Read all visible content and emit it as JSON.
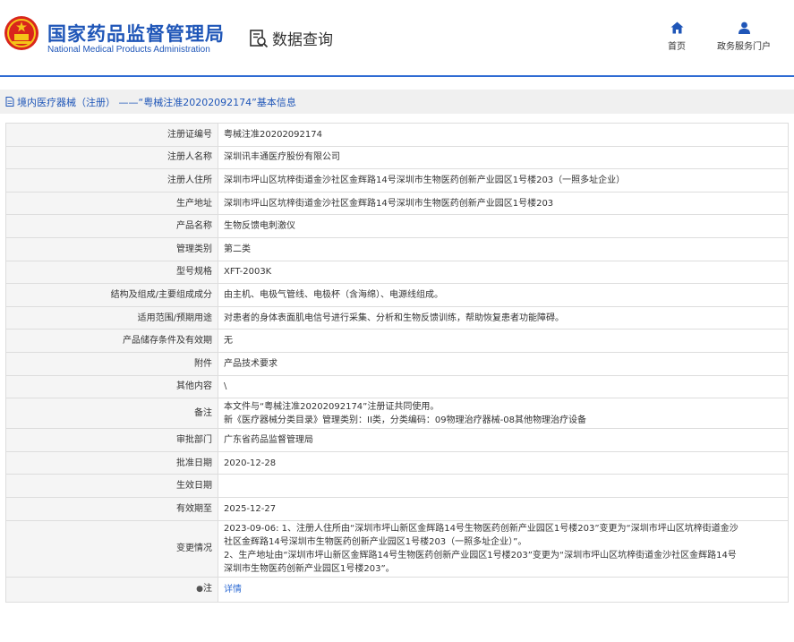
{
  "header": {
    "brand_cn": "国家药品监督管理局",
    "brand_en": "National Medical Products Administration",
    "query_label": "数据查询",
    "nav": {
      "home": "首页",
      "gov": "政务服务门户"
    }
  },
  "colors": {
    "brand": "#1f56b8",
    "accent": "#2e6bd3",
    "label_bg": "#f5f5f5",
    "title_bg": "#f0f0f0"
  },
  "icons": {
    "emblem": "national-emblem-icon",
    "query": "document-search-icon",
    "home": "home-icon",
    "user": "user-icon",
    "doc": "document-icon"
  },
  "page_title": "境内医疗器械（注册） ——“粤械注准20202092174”基本信息",
  "rows": [
    {
      "label": "注册证编号",
      "value": "粤械注准20202092174"
    },
    {
      "label": "注册人名称",
      "value": "深圳讯丰通医疗股份有限公司"
    },
    {
      "label": "注册人住所",
      "value": "深圳市坪山区坑梓街道金沙社区金辉路14号深圳市生物医药创新产业园区1号楼203（一照多址企业）"
    },
    {
      "label": "生产地址",
      "value": "深圳市坪山区坑梓街道金沙社区金辉路14号深圳市生物医药创新产业园区1号楼203"
    },
    {
      "label": "产品名称",
      "value": "生物反馈电刺激仪"
    },
    {
      "label": "管理类别",
      "value": "第二类"
    },
    {
      "label": "型号规格",
      "value": "XFT-2003K"
    },
    {
      "label": "结构及组成/主要组成成分",
      "value": "由主机、电极气管线、电极杯（含海绵）、电源线组成。"
    },
    {
      "label": "适用范围/预期用途",
      "value": "对患者的身体表面肌电信号进行采集、分析和生物反馈训练，帮助恢复患者功能障碍。"
    },
    {
      "label": "产品储存条件及有效期",
      "value": "无"
    },
    {
      "label": "附件",
      "value": "产品技术要求"
    },
    {
      "label": "其他内容",
      "value": "\\"
    },
    {
      "label": "备注",
      "value_lines": [
        "本文件与“粤械注准20202092174”注册证共同使用。",
        "新《医疗器械分类目录》管理类别：II类，分类编码：09物理治疗器械-08其他物理治疗设备"
      ]
    },
    {
      "label": "审批部门",
      "value": "广东省药品监督管理局"
    },
    {
      "label": "批准日期",
      "value": "2020-12-28"
    },
    {
      "label": "生效日期",
      "value": ""
    },
    {
      "label": "有效期至",
      "value": "2025-12-27"
    },
    {
      "label": "变更情况",
      "value_lines": [
        "2023-09-06: 1、注册人住所由“深圳市坪山新区金辉路14号生物医药创新产业园区1号楼203”变更为“深圳市坪山区坑梓街道金沙",
        "社区金辉路14号深圳市生物医药创新产业园区1号楼203（一照多址企业）”。",
        "2、生产地址由“深圳市坪山新区金辉路14号生物医药创新产业园区1号楼203”变更为“深圳市坪山区坑梓街道金沙社区金辉路14号",
        "深圳市生物医药创新产业园区1号楼203”。"
      ]
    },
    {
      "label": "注",
      "pin": "●",
      "value": "详情"
    }
  ]
}
